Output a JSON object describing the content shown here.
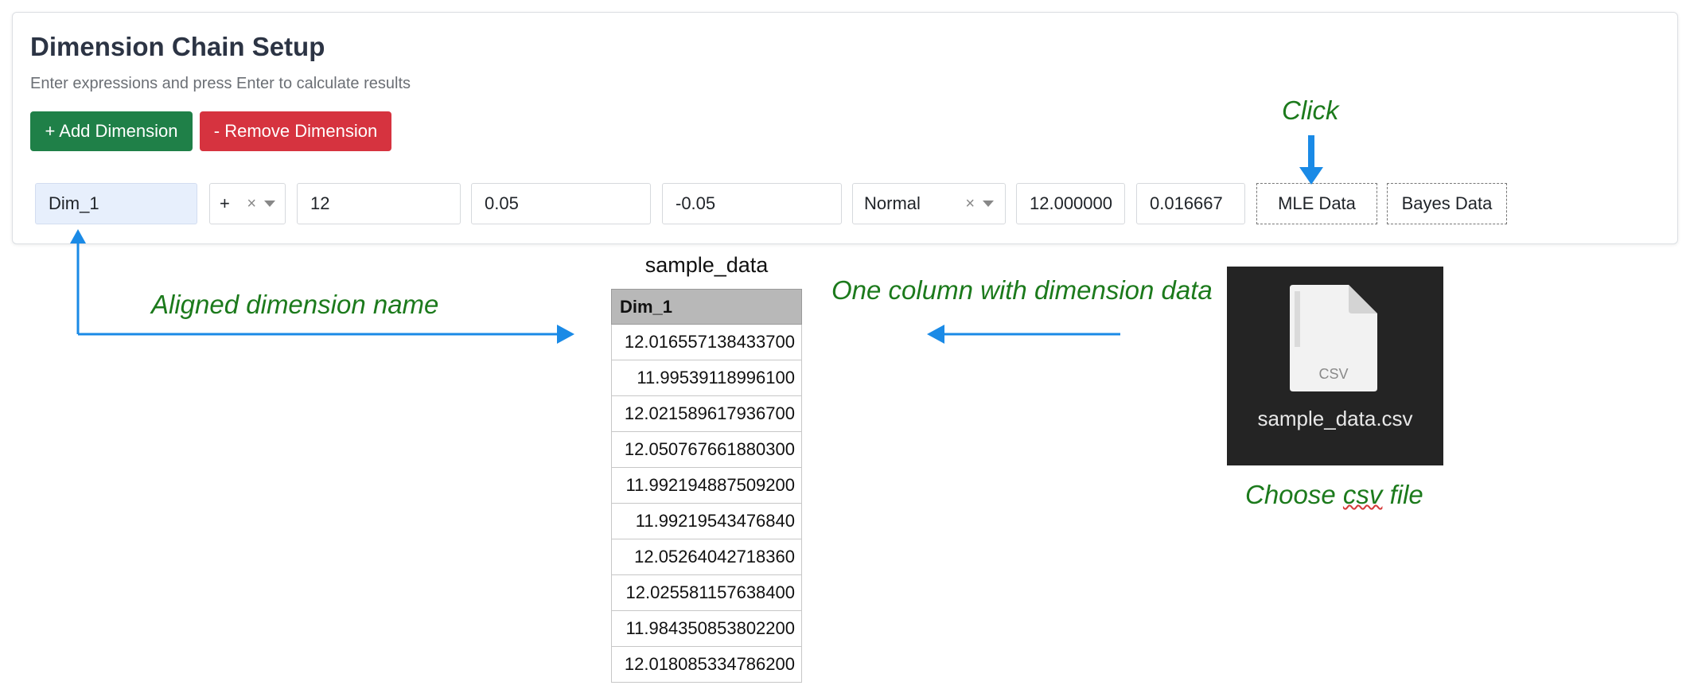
{
  "panel": {
    "title": "Dimension Chain Setup",
    "subtitle": "Enter expressions and press Enter to calculate results",
    "add_button_label": "+ Add Dimension",
    "remove_button_label": "- Remove Dimension"
  },
  "dimension_row": {
    "name": "Dim_1",
    "operator": "+",
    "nominal": "12",
    "upper_tolerance": "0.05",
    "lower_tolerance": "-0.05",
    "distribution": "Normal",
    "mean": "12.000000",
    "std": "0.016667",
    "mle_button_label": "MLE Data",
    "bayes_button_label": "Bayes Data"
  },
  "annotations": {
    "click": "Click",
    "aligned_name": "Aligned dimension name",
    "one_column": "One column with dimension data",
    "choose_prefix": "Choose ",
    "choose_csv": "csv",
    "choose_suffix": " file"
  },
  "sample_table": {
    "caption": "sample_data",
    "header": "Dim_1",
    "rows": [
      "12.016557138433700",
      "11.99539118996100",
      "12.021589617936700",
      "12.050767661880300",
      "11.992194887509200",
      "11.99219543476840",
      "12.05264042718360",
      "12.025581157638400",
      "11.984350853802200",
      "12.018085334786200"
    ]
  },
  "file_picker": {
    "file_name": "sample_data.csv",
    "icon_label": "CSV"
  },
  "colors": {
    "add_button": "#1f8048",
    "remove_button": "#d6333f",
    "annotation_text": "#1c7a1c",
    "arrow": "#1a8ae6"
  }
}
